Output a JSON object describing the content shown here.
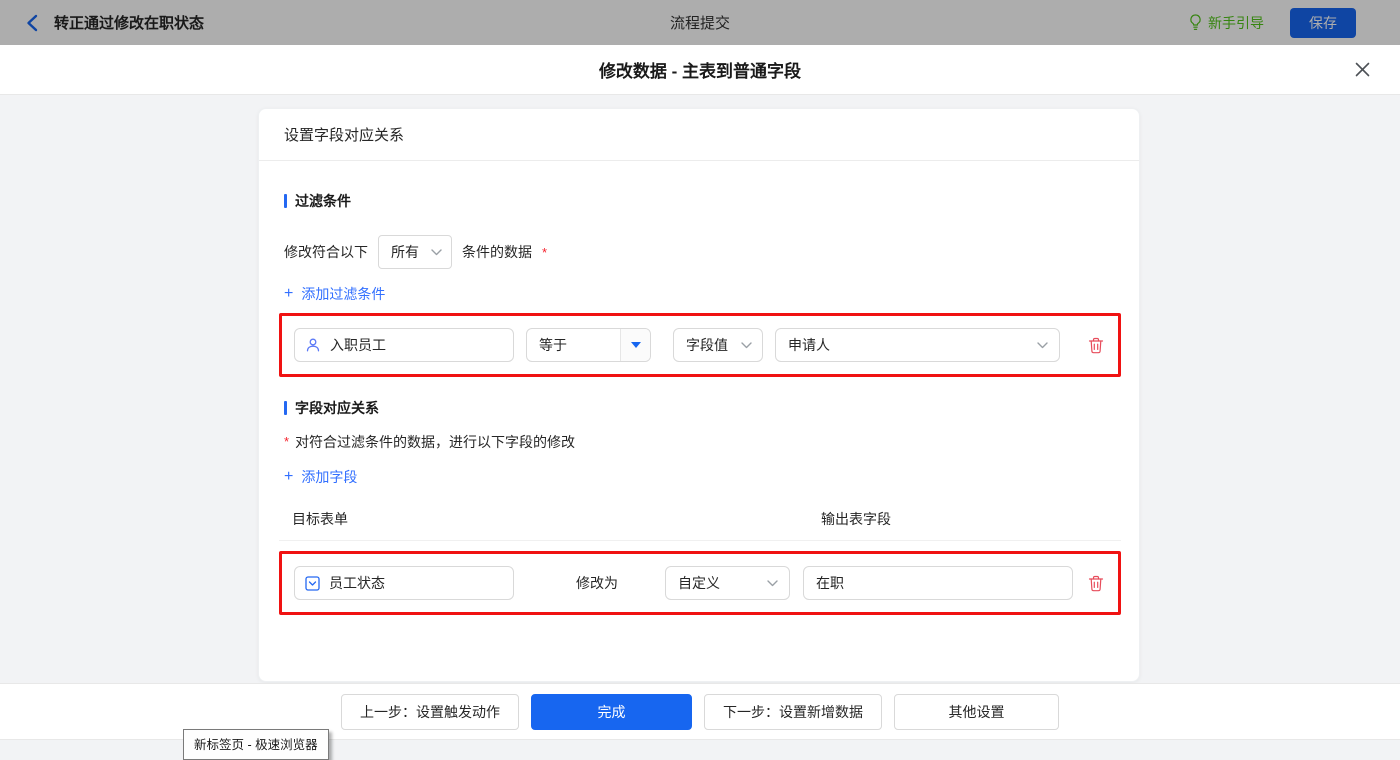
{
  "topbar": {
    "back_label": "转正通过修改在职状态",
    "center_title": "流程提交",
    "guide_label": "新手引导",
    "save_label": "保存"
  },
  "modal": {
    "title": "修改数据 - 主表到普通字段",
    "card_title": "设置字段对应关系",
    "filter_section": {
      "title": "过滤条件",
      "condition_prefix": "修改符合以下",
      "match_value": "所有",
      "condition_suffix": "条件的数据",
      "required_mark": "*",
      "add_label": "添加过滤条件",
      "row": {
        "field": "入职员工",
        "operator": "等于",
        "value_type": "字段值",
        "value": "申请人"
      }
    },
    "mapping_section": {
      "title": "字段对应关系",
      "required_mark": "*",
      "description": "对符合过滤条件的数据，进行以下字段的修改",
      "add_label": "添加字段",
      "columns": {
        "target": "目标表单",
        "output": "输出表字段"
      },
      "row": {
        "field": "员工状态",
        "modify_label": "修改为",
        "mode": "自定义",
        "value": "在职"
      }
    },
    "footer": {
      "prev_label": "上一步：设置触发动作",
      "done_label": "完成",
      "next_label": "下一步：设置新增数据",
      "other_label": "其他设置"
    }
  },
  "tooltip": "新标签页 - 极速浏览器",
  "icons": {
    "plus": "+",
    "back": "chevron-left",
    "guide": "lightbulb",
    "close": "x-mark",
    "filter_field": "user-outline",
    "operator_caret": "triangle-down",
    "select_chevron": "chevron-down",
    "target_field": "dropdown-square",
    "delete": "trash-can"
  },
  "colors": {
    "accent_blue": "#1766f0",
    "link_blue": "#3370ff",
    "section_bar_blue": "#2468f2",
    "guide_green": "#52c41a",
    "danger_red": "#e74c5b",
    "annotation_red": "#f01212",
    "required_red": "#f5222d"
  }
}
